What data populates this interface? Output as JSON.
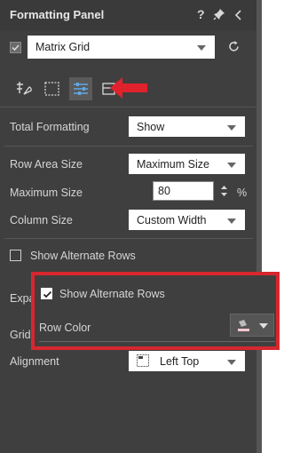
{
  "title": "Formatting Panel",
  "title_controls": {
    "help": "?",
    "pin": "pin-icon",
    "collapse": "chevron-left-icon"
  },
  "visual_selector": {
    "value": "Matrix Grid",
    "checked": true
  },
  "tabs": [
    {
      "icon": "general-format-icon",
      "active": false
    },
    {
      "icon": "border-icon",
      "active": false
    },
    {
      "icon": "sliders-icon",
      "active": true
    },
    {
      "icon": "grid-icon",
      "active": false
    }
  ],
  "fields": {
    "total_formatting": {
      "label": "Total Formatting",
      "value": "Show"
    },
    "row_area_size": {
      "label": "Row Area Size",
      "value": "Maximum Size"
    },
    "maximum_size": {
      "label": "Maximum Size",
      "value": "80",
      "unit": "%"
    },
    "column_size": {
      "label": "Column Size",
      "value": "Custom Width"
    },
    "show_alternate_rows": {
      "label": "Show Alternate Rows",
      "checked": false
    },
    "expand_partial": "Expa",
    "grid_partial": "Grid",
    "alignment": {
      "label": "Alignment",
      "value": "Left Top"
    }
  },
  "callout": {
    "show_alternate_rows": {
      "label": "Show Alternate Rows",
      "checked": true
    },
    "row_color": {
      "label": "Row Color"
    }
  },
  "colors": {
    "panel_bg": "#3f3f3f",
    "highlight": "#d7262e",
    "accent_arrow": "#e0222c"
  }
}
